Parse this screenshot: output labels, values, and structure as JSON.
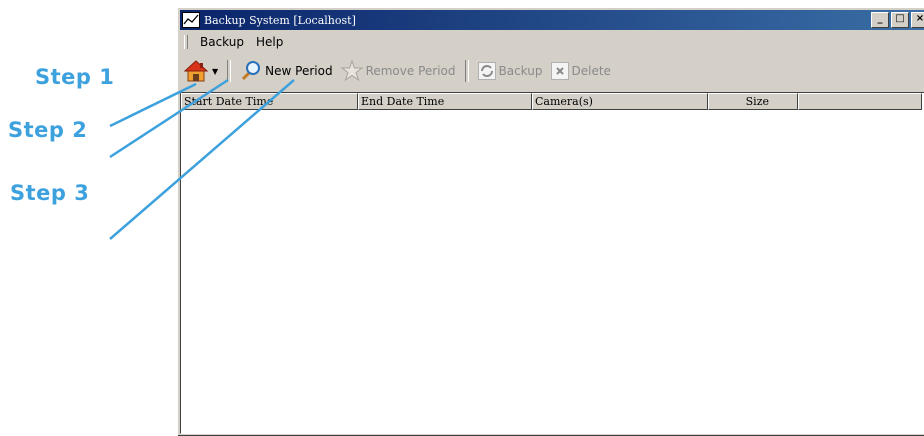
{
  "window": {
    "title": "Backup System [Localhost]"
  },
  "menu": [
    "Backup",
    "Help"
  ],
  "toolbar": {
    "new_period": "New Period",
    "remove_period": "Remove Period",
    "backup": "Backup",
    "delete": "Delete"
  },
  "columns": [
    "Start Date Time",
    "End Date Time",
    "Camera(s)",
    "Size"
  ],
  "steps": [
    "Step 1",
    "Step 2",
    "Step 3"
  ],
  "colors": {
    "callout": "#3da1dd",
    "titlebar": "#0a246a",
    "face": "#d4d0c8"
  }
}
